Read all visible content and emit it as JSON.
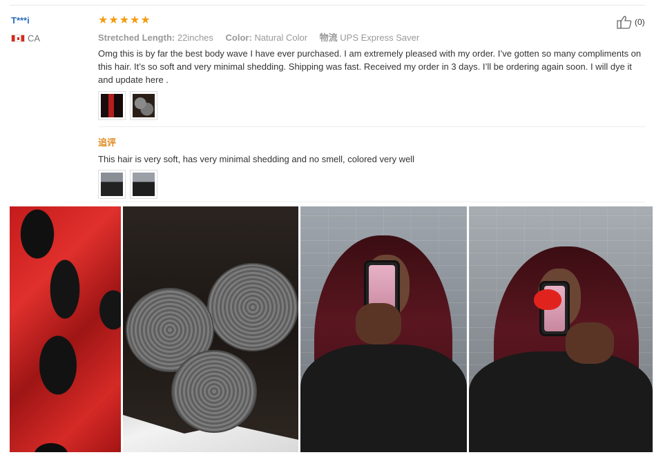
{
  "review": {
    "reviewer_name": "T***i",
    "country_code": "CA",
    "rating": 5,
    "attributes": [
      {
        "label": "Stretched Length:",
        "value": "22inches"
      },
      {
        "label": "Color:",
        "value": "Natural Color"
      },
      {
        "label": "物流",
        "value": "UPS Express Saver"
      }
    ],
    "helpful_count": "(0)",
    "text": "Omg this is by far the best body wave I have ever purchased. I am extremely pleased with my order. I’ve gotten so many compliments on this hair. It’s so soft and very minimal shedding. Shipping was fast. Received my order in 3 days. I’ll be ordering again soon. I will dye it and update here .",
    "followup_label": "追评",
    "followup_text": "This hair is very soft, has very minimal shedding and no smell, colored very well"
  },
  "colors": {
    "accent_star": "#f39c12",
    "reviewer_name": "#2a6ebb",
    "followup_label": "#e08a1e"
  },
  "icons": {
    "star": "star-icon",
    "thumb": "thumbs-up-icon",
    "flag": "canada-flag-icon"
  }
}
